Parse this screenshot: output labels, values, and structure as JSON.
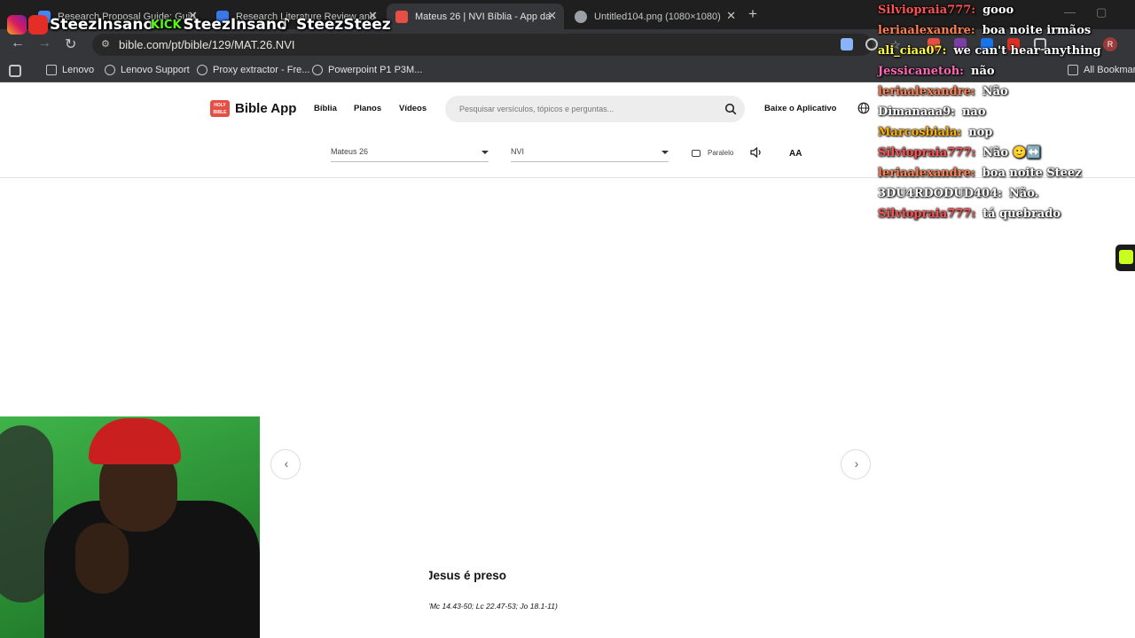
{
  "browser": {
    "tabs": [
      {
        "title": "Research Proposal Guide: Guid",
        "color": "#4285f4",
        "active": false
      },
      {
        "title": "Research Literature Review and",
        "color": "#3b78e7",
        "active": false
      },
      {
        "title": "Mateus 26 | NVI Bíblia - App da",
        "color": "#e64f43",
        "active": true
      },
      {
        "title": "Untitled104.png (1080×1080)",
        "color": "#9aa0a6",
        "active": false
      }
    ],
    "close_glyph": "✕",
    "newtab_glyph": "+",
    "url": "bible.com/pt/bible/129/MAT.26.NVI",
    "profile_initial": "R",
    "bookmarks": [
      {
        "label": "Lenovo",
        "icon": "folder-icon"
      },
      {
        "label": "Lenovo Support",
        "icon": "globe-icon"
      },
      {
        "label": "Proxy extractor - Fre...",
        "icon": "globe-icon"
      },
      {
        "label": "Powerpoint P1 P3M...",
        "icon": "globe-icon"
      }
    ],
    "all_bookmarks": "All Bookmarks"
  },
  "app": {
    "logo_mark": "HOLY BIBLE",
    "logo_text": "Bible App",
    "nav": [
      "Bíblia",
      "Planos",
      "Vídeos"
    ],
    "search_placeholder": "Pesquisar versículos, tópicos e perguntas...",
    "download_label": "Baixe o Aplicativo",
    "book_select": "Mateus 26",
    "version_select": "NVI",
    "parallel_label": "Paralelo",
    "font_size_label": "AA",
    "prev_glyph": "‹",
    "next_glyph": "›"
  },
  "reader": {
    "heading": "Jesus é preso",
    "xref": "(Mc 14.43-50; Lc 22.47-53; Jo 18.1-11)"
  },
  "overlay": {
    "brands": [
      {
        "label": "SteezInsano",
        "platform": "instagram-youtube"
      },
      {
        "label": "SteezInsano",
        "platform": "kick"
      },
      {
        "label": "SteezSteez",
        "platform": "tiktok"
      }
    ],
    "kick_label": "KICK",
    "chat": [
      {
        "user": "Silviopraia777:",
        "text": "gooo",
        "color": "#ff5151"
      },
      {
        "user": "leriaalexandre:",
        "text": "boa noite irmãos",
        "color": "#ff7f50"
      },
      {
        "user": "ali_ciaa07:",
        "text": "we can't hear anything",
        "color": "#ffff40"
      },
      {
        "user": "Jessicanetoh:",
        "text": "não",
        "color": "#ff69b4"
      },
      {
        "user": "leriaalexandre:",
        "text": "Não",
        "color": "#ff7f50"
      },
      {
        "user": "Dimanaaa9:",
        "text": "nao",
        "color": "#ffffff"
      },
      {
        "user": "Marcosbiala:",
        "text": "nop",
        "color": "#ffb000"
      },
      {
        "user": "Silviopraia777:",
        "text": "Não 🙂↔️",
        "color": "#ff5151"
      },
      {
        "user": "leriaalexandre:",
        "text": "boa noite Steez",
        "color": "#ff7f50"
      },
      {
        "user": "3DU4RDODUD404:",
        "text": "Não.",
        "color": "#ffffff"
      },
      {
        "user": "Silviopraia777:",
        "text": "tá quebrado",
        "color": "#ff5151"
      }
    ]
  }
}
